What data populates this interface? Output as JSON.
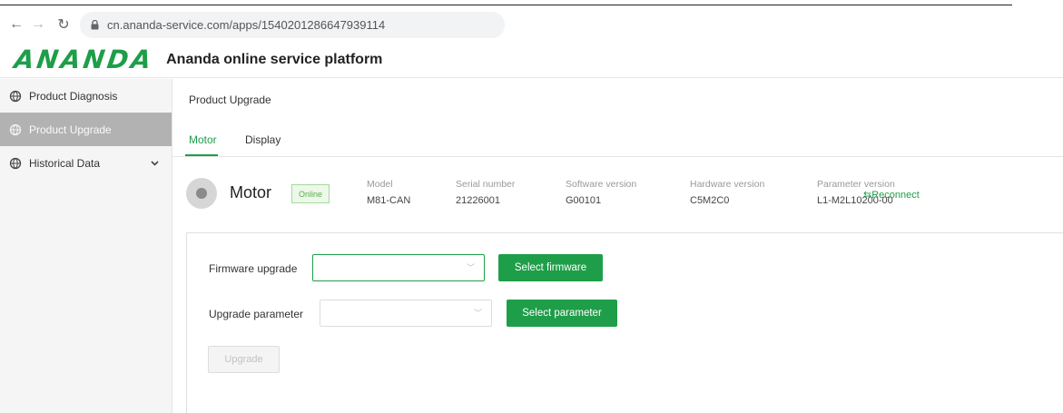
{
  "browser": {
    "url": "cn.ananda-service.com/apps/1540201286647939114"
  },
  "header": {
    "logo_text": "ANANDA",
    "platform_title": "Ananda online service platform"
  },
  "sidebar": {
    "items": [
      {
        "label": "Product Diagnosis",
        "icon": "globe-icon",
        "active": false
      },
      {
        "label": "Product Upgrade",
        "icon": "globe-icon",
        "active": true
      },
      {
        "label": "Historical Data",
        "icon": "globe-icon",
        "active": false,
        "expandable": true
      }
    ]
  },
  "main": {
    "breadcrumb": "Product Upgrade",
    "tabs": [
      {
        "label": "Motor",
        "active": true
      },
      {
        "label": "Display",
        "active": false
      }
    ],
    "device": {
      "name": "Motor",
      "status": "Online",
      "fields": [
        {
          "label": "Model",
          "value": "M81-CAN"
        },
        {
          "label": "Serial number",
          "value": "21226001"
        },
        {
          "label": "Software version",
          "value": "G00101"
        },
        {
          "label": "Hardware version",
          "value": "C5M2C0"
        },
        {
          "label": "Parameter version",
          "value": "L1-M2L10200-00"
        }
      ],
      "reconnect_label": "⇆Reconnect"
    },
    "form": {
      "firmware_label": "Firmware upgrade",
      "firmware_value": "",
      "select_firmware_button": "Select firmware",
      "parameter_label": "Upgrade parameter",
      "parameter_value": "",
      "select_parameter_button": "Select parameter",
      "upgrade_button": "Upgrade"
    }
  },
  "colors": {
    "accent": "#1e9e48",
    "sidebar_active_bg": "#b2b2b2",
    "online_badge": "#55b04a"
  }
}
